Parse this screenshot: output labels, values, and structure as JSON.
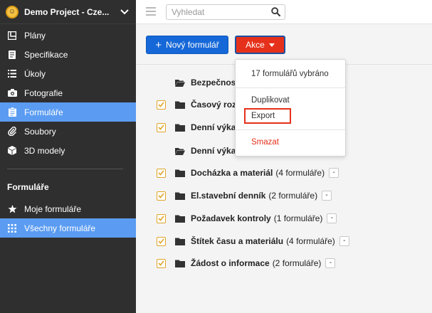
{
  "project": {
    "name": "Demo Project - Cze..."
  },
  "sidebar": {
    "items": [
      {
        "label": "Plány",
        "icon": "floorplan-icon"
      },
      {
        "label": "Specifikace",
        "icon": "specification-icon"
      },
      {
        "label": "Úkoly",
        "icon": "task-list-icon"
      },
      {
        "label": "Fotografie",
        "icon": "camera-icon"
      },
      {
        "label": "Formuláře",
        "icon": "clipboard-icon",
        "active": true
      },
      {
        "label": "Soubory",
        "icon": "paperclip-icon"
      },
      {
        "label": "3D modely",
        "icon": "cube-icon"
      }
    ],
    "section_title": "Formuláře",
    "forms_items": [
      {
        "label": "Moje formuláře",
        "icon": "star-icon"
      },
      {
        "label": "Všechny formuláře",
        "icon": "grid-icon",
        "active": true
      }
    ]
  },
  "search": {
    "placeholder": "Vyhledat",
    "value": ""
  },
  "toolbar": {
    "new_label": "Nový formulář",
    "actions_label": "Akce"
  },
  "dropdown": {
    "summary": "17 formulářů vybráno",
    "duplicate": "Duplikovat",
    "export": "Export",
    "delete": "Smazat"
  },
  "rows": [
    {
      "name": "Bezpečnostn",
      "count": "",
      "checked": false
    },
    {
      "name": "Časový rozv",
      "count": "",
      "checked": true
    },
    {
      "name": "Denní výkaz",
      "count": "",
      "checked": true
    },
    {
      "name": "Denní výkaz",
      "count": "",
      "checked": false
    },
    {
      "name": "Docházka a materiál",
      "count": "(4 formuláře)",
      "checked": true,
      "expand": "-"
    },
    {
      "name": "El.stavební denník",
      "count": "(2 formuláře)",
      "checked": true,
      "expand": "-"
    },
    {
      "name": "Požadavek kontroly",
      "count": "(1 formuláře)",
      "checked": true,
      "expand": "-"
    },
    {
      "name": "Štítek času a materiálu",
      "count": "(4 formuláře)",
      "checked": true,
      "expand": "-"
    },
    {
      "name": "Žádost o informace",
      "count": "(2 formuláře)",
      "checked": true,
      "expand": "-"
    }
  ],
  "colors": {
    "sidebar_bg": "#2f2f2f",
    "active_item": "#5b9cf2",
    "primary_button": "#1668d8",
    "danger_button": "#e5311b",
    "checkbox_border": "#e0a52a"
  }
}
